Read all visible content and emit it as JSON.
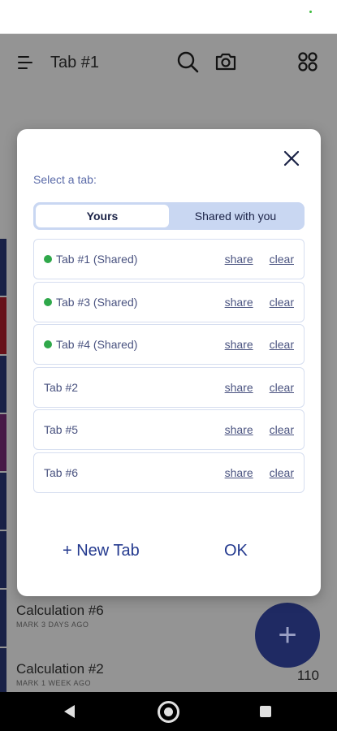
{
  "app": {
    "title": "Tab #1"
  },
  "background": {
    "rows": [
      {
        "title": "Calculation #6",
        "subtitle": "MARK 3 DAYS AGO"
      },
      {
        "title": "Calculation #2",
        "subtitle": "MARK 1 WEEK AGO",
        "value": "110"
      }
    ],
    "fab_label": "+"
  },
  "dialog": {
    "label": "Select a tab:",
    "segments": [
      {
        "label": "Yours",
        "active": true
      },
      {
        "label": "Shared with you",
        "active": false
      }
    ],
    "tabs": [
      {
        "name": "Tab #1 (Shared)",
        "shared": true,
        "share": "share",
        "clear": "clear"
      },
      {
        "name": "Tab #3 (Shared)",
        "shared": true,
        "share": "share",
        "clear": "clear"
      },
      {
        "name": "Tab #4 (Shared)",
        "shared": true,
        "share": "share",
        "clear": "clear"
      },
      {
        "name": "Tab #2",
        "shared": false,
        "share": "share",
        "clear": "clear"
      },
      {
        "name": "Tab #5",
        "shared": false,
        "share": "share",
        "clear": "clear"
      },
      {
        "name": "Tab #6",
        "shared": false,
        "share": "share",
        "clear": "clear"
      }
    ],
    "new_tab": "+ New Tab",
    "ok": "OK"
  },
  "colors": {
    "accent": "#243a8f",
    "shared_dot": "#2fa84a",
    "fab": "#1f2a63",
    "segment_bg": "#c9d7f2",
    "strip_colors": [
      "#2b3a7a",
      "#b32030",
      "#2b3a7a",
      "#7a2b7a",
      "#2b3a7a",
      "#2b3a7a",
      "#2b3a7a",
      "#2b3a7a"
    ]
  }
}
